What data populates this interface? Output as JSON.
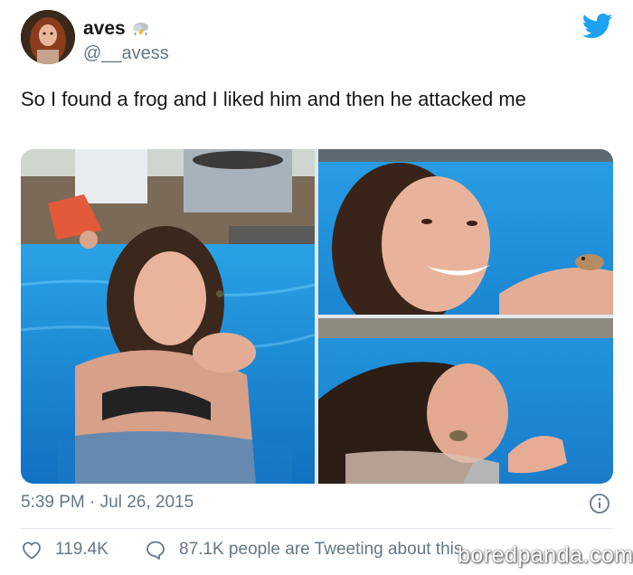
{
  "author": {
    "display_name": "aves",
    "handle": "@__avess",
    "avatar_icon": "profile-photo",
    "name_emoji_icon": "cloud-lightning-rain-icon"
  },
  "brand": {
    "icon": "twitter-bird-icon",
    "color": "#1da1f2"
  },
  "tweet": {
    "text": "So I found a frog and I liked him and then he attacked me",
    "timestamp": "5:39 PM · Jul 26, 2015"
  },
  "media": {
    "photos": [
      {
        "icon": "pool-photo-holding-frog"
      },
      {
        "icon": "pool-photo-smiling-frog-on-hand"
      },
      {
        "icon": "pool-photo-frog-attack"
      }
    ]
  },
  "actions": {
    "like_count": "119.4K",
    "reply_text": "87.1K people are Tweeting about this"
  },
  "watermark": {
    "text": "boredpanda.com"
  },
  "colors": {
    "text_primary": "#14171a",
    "text_secondary": "#657786",
    "divider": "#e1e8ed",
    "pool_blue": "#1f8fd6"
  }
}
